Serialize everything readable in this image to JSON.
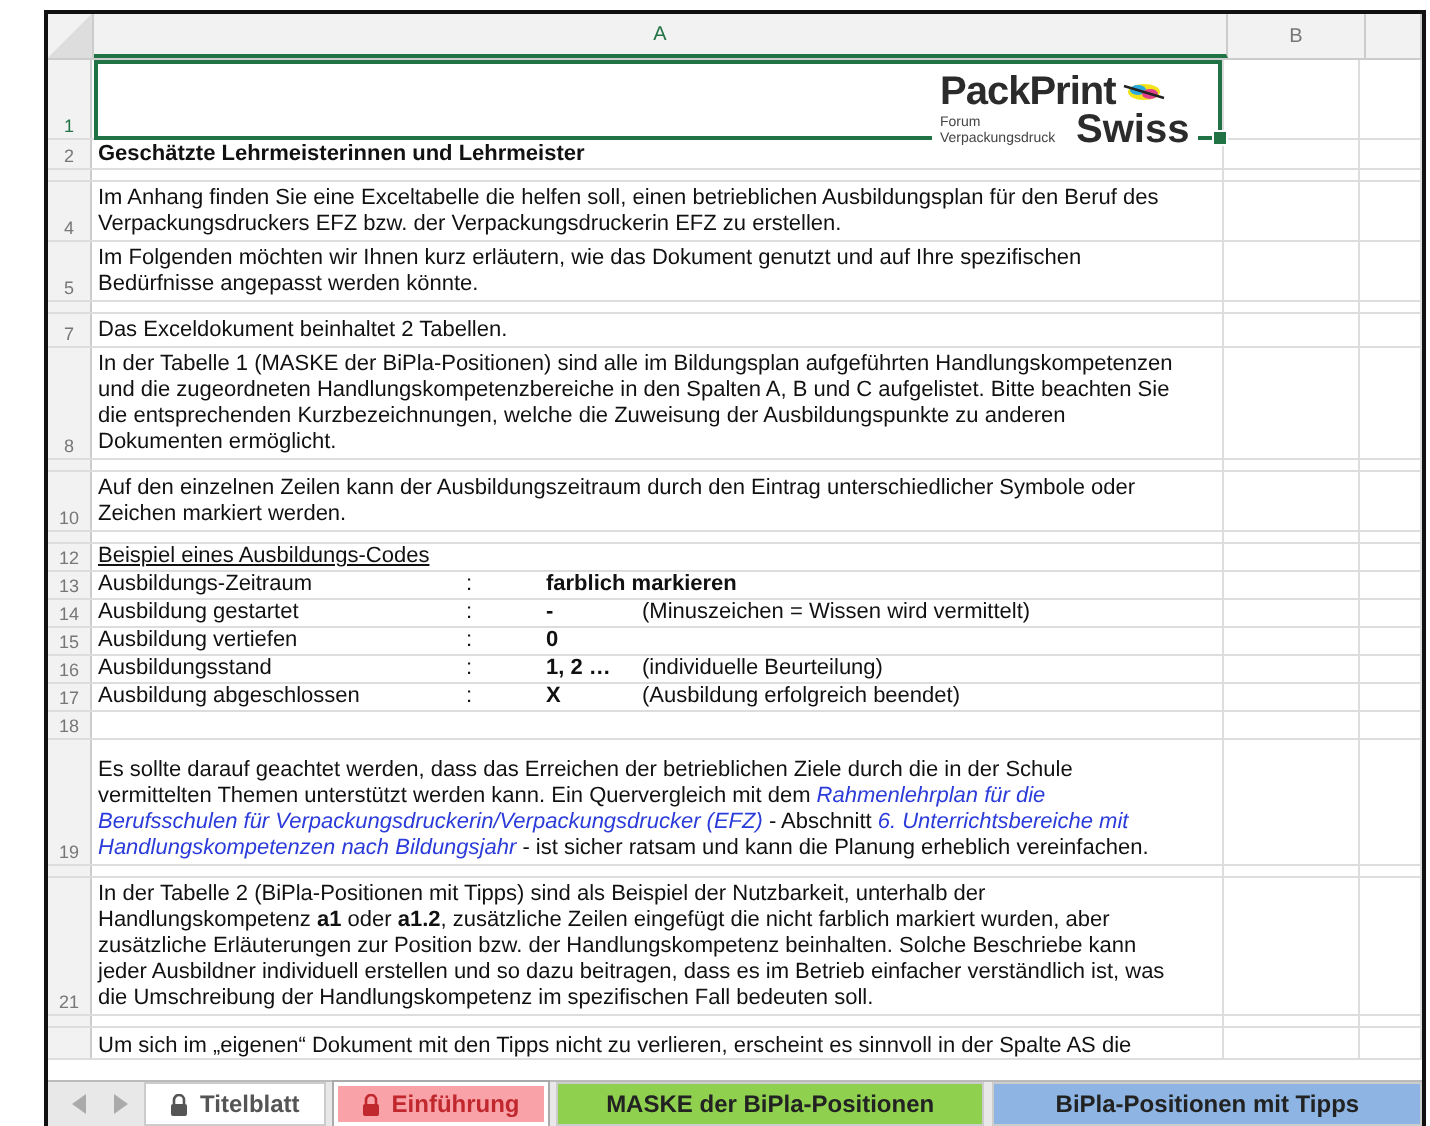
{
  "columns": [
    {
      "label": "A",
      "selected": true
    },
    {
      "label": "B",
      "selected": false
    }
  ],
  "logo": {
    "name": "PackPrint",
    "sub": "Forum Verpackungsdruck",
    "country": "Swiss"
  },
  "rows": [
    {
      "number": "1",
      "kind": "banner"
    },
    {
      "number": "2",
      "kind": "heading",
      "text": "Geschätzte Lehrmeisterinnen und Lehrmeister"
    },
    {
      "kind": "spacer"
    },
    {
      "number": "4",
      "kind": "text",
      "text": "Im Anhang finden Sie eine Exceltabelle die helfen soll, einen betrieblichen Ausbildungsplan für den Beruf des Verpackungsdruckers EFZ bzw. der Verpackungsdruckerin EFZ zu erstellen."
    },
    {
      "number": "5",
      "kind": "text",
      "text": "Im Folgenden möchten wir Ihnen kurz erläutern, wie das Dokument genutzt und auf Ihre spezifischen Bedürfnisse angepasst werden könnte."
    },
    {
      "kind": "spacer"
    },
    {
      "number": "7",
      "kind": "text",
      "text": "Das Exceldokument beinhaltet 2 Tabellen."
    },
    {
      "number": "8",
      "kind": "text",
      "text": "In der Tabelle 1 (MASKE der BiPla-Positionen) sind alle im Bildungsplan aufgeführten Handlungskompetenzen und die zugeordneten Handlungskompetenzbereiche in den Spalten A, B und C aufgelistet. Bitte beachten Sie die entsprechenden Kurzbezeichnungen, welche die Zuweisung der Ausbildungspunkte zu anderen Dokumenten ermöglicht."
    },
    {
      "kind": "spacer"
    },
    {
      "number": "10",
      "kind": "text",
      "text": "Auf den einzelnen Zeilen kann der Ausbildungszeitraum durch den Eintrag unterschiedlicher Symbole oder Zeichen markiert werden."
    },
    {
      "kind": "spacer"
    },
    {
      "number": "12",
      "kind": "underlined",
      "text": "Beispiel eines Ausbildungs-Codes"
    },
    {
      "number": "13",
      "kind": "code",
      "label": "Ausbildungs-Zeitraum",
      "colon": ":",
      "value": "farblich markieren"
    },
    {
      "number": "14",
      "kind": "code",
      "label": "Ausbildung gestartet",
      "colon": ":",
      "value": "-",
      "note": "(Minuszeichen = Wissen wird vermittelt)"
    },
    {
      "number": "15",
      "kind": "code",
      "label": "Ausbildung vertiefen",
      "colon": ":",
      "value": "0"
    },
    {
      "number": "16",
      "kind": "code",
      "label": "Ausbildungsstand",
      "colon": ":",
      "value": "1, 2 …",
      "note": "(individuelle Beurteilung)"
    },
    {
      "number": "17",
      "kind": "code",
      "label": "Ausbildung abgeschlossen",
      "colon": ":",
      "value": "X",
      "note": "(Ausbildung erfolgreich beendet)"
    },
    {
      "number": "18",
      "kind": "blank"
    },
    {
      "number": "19",
      "kind": "links",
      "lines": [
        [
          {
            "kind": "text",
            "text": "Es sollte darauf geachtet werden, dass das Erreichen der betrieblichen Ziele durch die in der Schule"
          }
        ],
        [
          {
            "kind": "text",
            "text": "vermittelten Themen unterstützt werden kann. Ein Quervergleich mit dem "
          },
          {
            "kind": "link",
            "text": "Rahmenlehrplan für die"
          }
        ],
        [
          {
            "kind": "link",
            "text": "Berufsschulen für Verpackungsdruckerin/Verpackungsdrucker (EFZ)"
          },
          {
            "kind": "text",
            "text": "  - Abschnitt "
          },
          {
            "kind": "link",
            "text": "6. Unterrichtsbereiche mit"
          }
        ],
        [
          {
            "kind": "link",
            "text": "Handlungskompetenzen nach Bildungsjahr"
          },
          {
            "kind": "text",
            "text": "  -  ist sicher ratsam und kann die Planung erheblich vereinfachen."
          }
        ]
      ]
    },
    {
      "kind": "spacer"
    },
    {
      "number": "21",
      "kind": "text",
      "text": "In der Tabelle 2 (BiPla-Positionen mit Tipps) sind als Beispiel der Nutzbarkeit,  unterhalb der Handlungskompetenz **a1** oder **a1.2**, zusätzliche Zeilen eingefügt die nicht farblich markiert wurden, aber zusätzliche Erläuterungen zur Position bzw. der Handlungskompetenz beinhalten. Solche Beschriebe kann jeder Ausbildner individuell erstellen und so dazu beitragen, dass es im Betrieb einfacher verständlich ist, was die Umschreibung der Handlungskompetenz im spezifischen Fall bedeuten soll."
    },
    {
      "kind": "spacer"
    },
    {
      "kind": "partial",
      "text": "Um sich im „eigenen“ Dokument mit den Tipps nicht zu verlieren, erscheint es sinnvoll in der Spalte AS die"
    }
  ],
  "tabs": [
    {
      "label": "Titelblatt",
      "locked": true,
      "color": "#ffffff",
      "selected": false
    },
    {
      "label": "Einführung",
      "locked": true,
      "color": "#f9a3a8",
      "selected": true
    },
    {
      "label": "MASKE der BiPla-Positionen",
      "locked": false,
      "color": "#8fd14f",
      "selected": false
    },
    {
      "label": "BiPla-Positionen mit Tipps",
      "locked": false,
      "color": "#8db4e2",
      "selected": false
    }
  ]
}
